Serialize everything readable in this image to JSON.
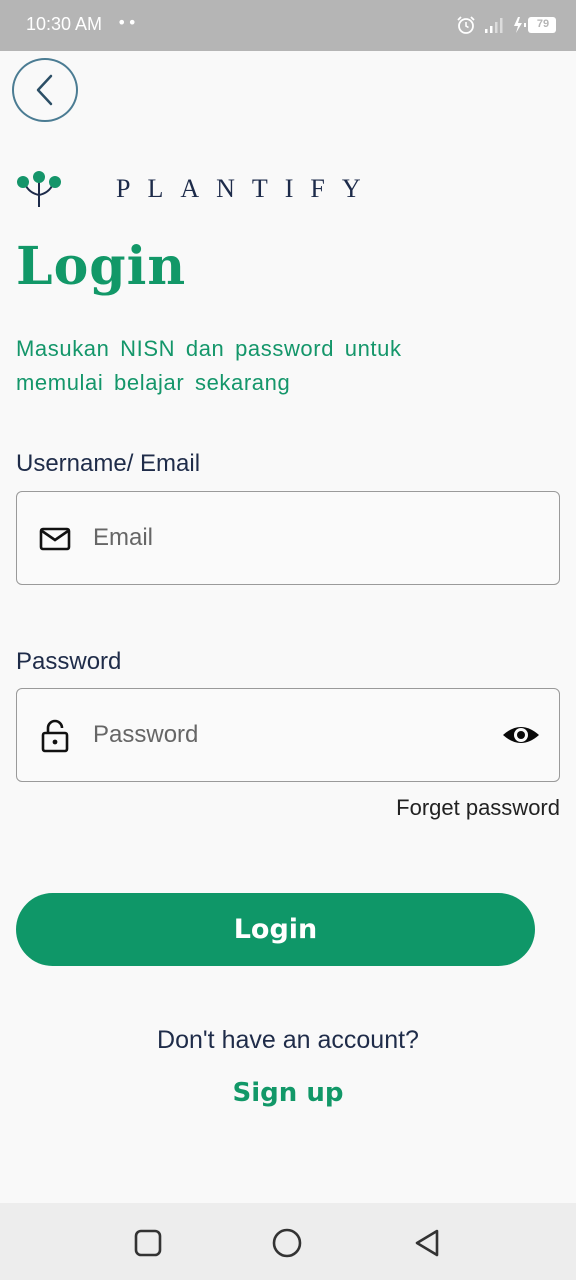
{
  "status_bar": {
    "time": "10:30 AM",
    "dots": "••",
    "battery": "79",
    "icons": [
      "alarm-icon",
      "signal-icon",
      "battery-charging-icon"
    ]
  },
  "header": {
    "back_icon": "chevron-left-icon"
  },
  "brand": {
    "name": "PLANTIFY",
    "logo_icon": "plant-logo-icon"
  },
  "login": {
    "title": "Login",
    "subtitle_line1": "Masukan NISN dan password untuk",
    "subtitle_line2": "memulai belajar sekarang",
    "username_label": "Username/ Email",
    "email_placeholder": "Email",
    "email_value": "",
    "email_icon": "mail-icon",
    "password_label": "Password",
    "password_placeholder": "Password",
    "password_value": "",
    "password_icon": "lock-icon",
    "visibility_icon": "eye-icon",
    "forget_password": "Forget password",
    "login_button": "Login",
    "signup_prompt": "Don't have an account?",
    "signup_link": "Sign up"
  },
  "colors": {
    "accent": "#0f9768",
    "text_dark": "#1f2c49",
    "status_bar": "#b5b5b5"
  },
  "nav_bar": {
    "icons": [
      "recent-apps-icon",
      "home-icon",
      "back-nav-icon"
    ]
  }
}
